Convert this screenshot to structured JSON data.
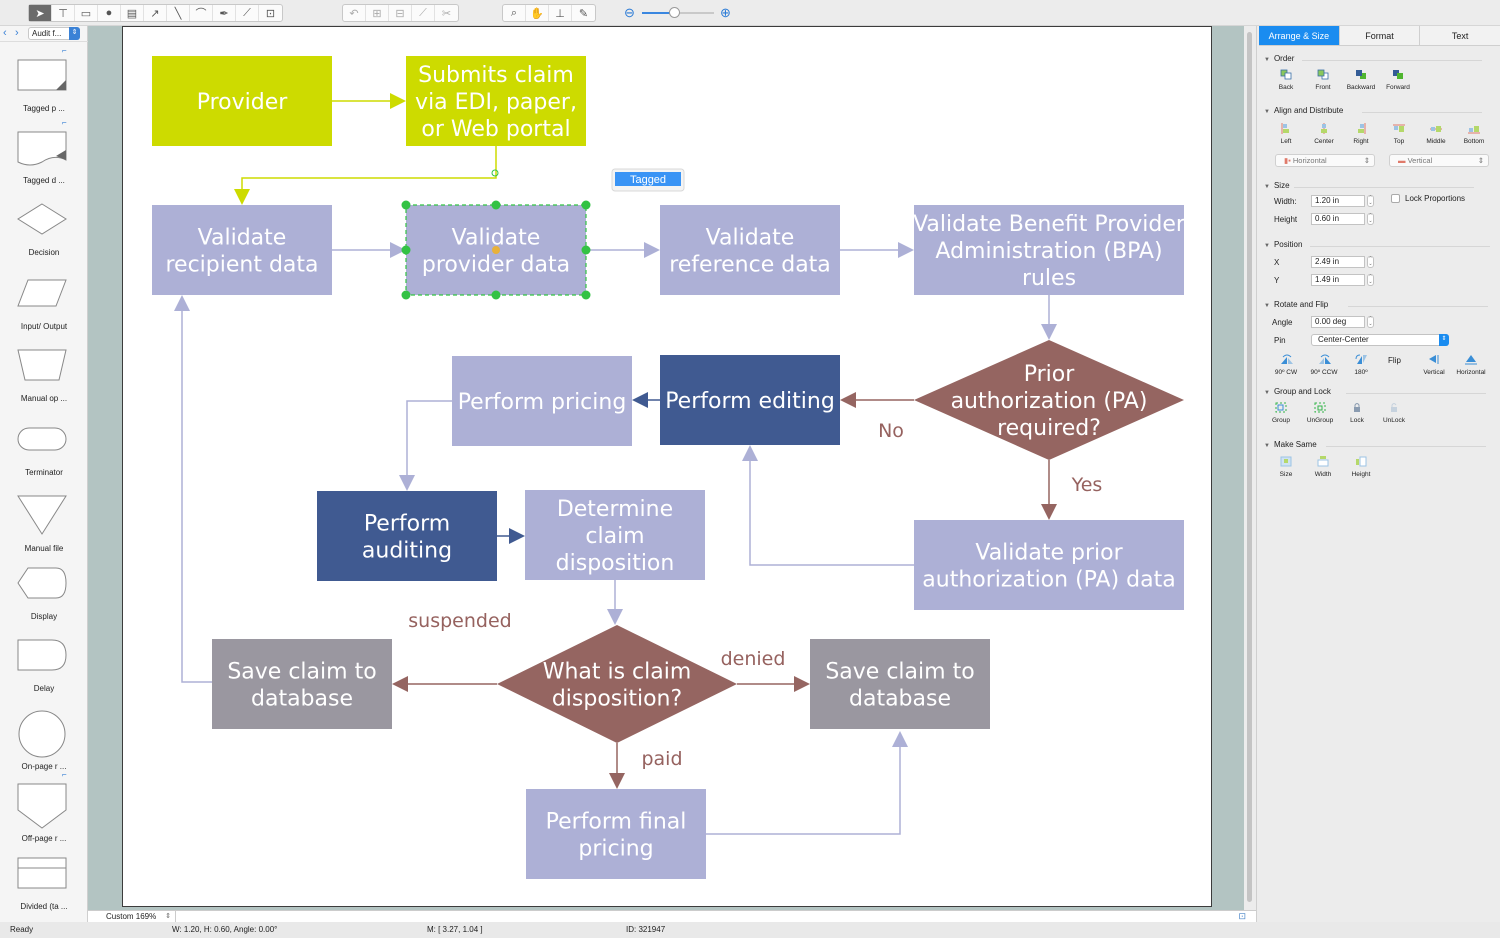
{
  "toolbar": {
    "draw_tools": [
      "pointer",
      "text-box",
      "rectangle",
      "ellipse",
      "note",
      "arrow",
      "line",
      "arc",
      "pen",
      "bezier-select",
      "insert-container"
    ],
    "edit_tools": [
      "rotate",
      "group",
      "ungroup",
      "connect",
      "disconnect"
    ],
    "view_tools": [
      "search",
      "pan",
      "stamp",
      "eyedropper"
    ],
    "zoom_level": 0.45
  },
  "library": {
    "selector_label": "Audit f...",
    "items": [
      {
        "label": "Tagged p ...",
        "shape": "tagged-process",
        "tagged": true
      },
      {
        "label": "Tagged d ...",
        "shape": "tagged-document",
        "tagged": true
      },
      {
        "label": "Decision",
        "shape": "decision"
      },
      {
        "label": "Input/ Output",
        "shape": "input-output"
      },
      {
        "label": "Manual op ...",
        "shape": "manual-operation"
      },
      {
        "label": "Terminator",
        "shape": "terminator"
      },
      {
        "label": "Manual file",
        "shape": "manual-file"
      },
      {
        "label": "Display",
        "shape": "display"
      },
      {
        "label": "Delay",
        "shape": "delay"
      },
      {
        "label": "On-page r ...",
        "shape": "on-page-reference"
      },
      {
        "label": "Off-page r ...",
        "shape": "off-page-reference",
        "tagged": true
      },
      {
        "label": "Divided (ta ...",
        "shape": "divided"
      }
    ]
  },
  "diagram": {
    "colors": {
      "green": "#cddb00",
      "green_text": "#5a5a6a",
      "lavender": "#adb0d6",
      "navy": "#405a91",
      "mauve": "#956561",
      "gray": "#9a97a0",
      "edge_lavender": "#adb0d6",
      "edge_green": "#cddb00",
      "edge_mauve": "#956561",
      "edge_navy": "#405a91",
      "selection": "#33c244"
    },
    "nodes": [
      {
        "id": "provider",
        "lines": [
          "Provider"
        ],
        "style": "green",
        "shape": "rect"
      },
      {
        "id": "submits",
        "lines": [
          "Submits claim",
          "via EDI, paper,",
          "or Web portal"
        ],
        "style": "green",
        "shape": "rect"
      },
      {
        "id": "val-recipient",
        "lines": [
          "Validate",
          "recipient data"
        ],
        "style": "lavender",
        "shape": "rect"
      },
      {
        "id": "val-provider",
        "lines": [
          "Validate",
          "provider data"
        ],
        "style": "lavender",
        "shape": "rect",
        "selected": true
      },
      {
        "id": "val-reference",
        "lines": [
          "Validate",
          "reference data"
        ],
        "style": "lavender",
        "shape": "rect"
      },
      {
        "id": "val-bpa",
        "lines": [
          "Validate Benefit Provider",
          "Administration (BPA)",
          "rules"
        ],
        "style": "lavender",
        "shape": "rect"
      },
      {
        "id": "pa-required",
        "lines": [
          "Prior",
          "authorization (PA)",
          "required?"
        ],
        "style": "mauve",
        "shape": "diamond"
      },
      {
        "id": "perform-editing",
        "lines": [
          "Perform editing"
        ],
        "style": "navy",
        "shape": "rect"
      },
      {
        "id": "perform-pricing",
        "lines": [
          "Perform pricing"
        ],
        "style": "lavender",
        "shape": "rect"
      },
      {
        "id": "perform-auditing",
        "lines": [
          "Perform",
          "auditing"
        ],
        "style": "navy",
        "shape": "rect"
      },
      {
        "id": "determine-disposition",
        "lines": [
          "Determine",
          "claim",
          "disposition"
        ],
        "style": "lavender",
        "shape": "rect"
      },
      {
        "id": "val-pa",
        "lines": [
          "Validate prior",
          "authorization (PA) data"
        ],
        "style": "lavender",
        "shape": "rect"
      },
      {
        "id": "what-disposition",
        "lines": [
          "What is claim",
          "disposition?"
        ],
        "style": "mauve",
        "shape": "diamond"
      },
      {
        "id": "save-suspended",
        "lines": [
          "Save claim to",
          "database"
        ],
        "style": "gray",
        "shape": "rect"
      },
      {
        "id": "save-denied",
        "lines": [
          "Save claim to",
          "database"
        ],
        "style": "gray",
        "shape": "rect"
      },
      {
        "id": "final-pricing",
        "lines": [
          "Perform final",
          "pricing"
        ],
        "style": "lavender",
        "shape": "rect"
      }
    ],
    "edges": [
      {
        "from": "provider",
        "to": "submits",
        "color": "edge_green"
      },
      {
        "from": "submits",
        "to": "val-recipient",
        "color": "edge_green"
      },
      {
        "from": "val-recipient",
        "to": "val-provider",
        "color": "edge_lavender"
      },
      {
        "from": "val-provider",
        "to": "val-reference",
        "color": "edge_lavender"
      },
      {
        "from": "val-reference",
        "to": "val-bpa",
        "color": "edge_lavender"
      },
      {
        "from": "val-bpa",
        "to": "pa-required",
        "color": "edge_lavender"
      },
      {
        "from": "pa-required",
        "to": "perform-editing",
        "color": "edge_mauve",
        "label": "No"
      },
      {
        "from": "pa-required",
        "to": "val-pa",
        "color": "edge_mauve",
        "label": "Yes"
      },
      {
        "from": "val-pa",
        "to": "perform-editing",
        "color": "edge_lavender"
      },
      {
        "from": "perform-editing",
        "to": "perform-pricing",
        "color": "edge_navy"
      },
      {
        "from": "perform-pricing",
        "to": "perform-auditing",
        "color": "edge_lavender"
      },
      {
        "from": "perform-auditing",
        "to": "determine-disposition",
        "color": "edge_navy"
      },
      {
        "from": "determine-disposition",
        "to": "what-disposition",
        "color": "edge_lavender"
      },
      {
        "from": "what-disposition",
        "to": "save-suspended",
        "color": "edge_mauve",
        "label": "suspended"
      },
      {
        "from": "what-disposition",
        "to": "save-denied",
        "color": "edge_mauve",
        "label": "denied"
      },
      {
        "from": "what-disposition",
        "to": "final-pricing",
        "color": "edge_mauve",
        "label": "paid"
      },
      {
        "from": "final-pricing",
        "to": "save-denied",
        "color": "edge_lavender"
      },
      {
        "from": "save-suspended",
        "to": "val-recipient",
        "color": "edge_lavender"
      }
    ],
    "tag_popup": "Tagged"
  },
  "inspector": {
    "tabs": [
      {
        "label": "Arrange & Size",
        "active": true
      },
      {
        "label": "Format",
        "active": false
      },
      {
        "label": "Text",
        "active": false
      }
    ],
    "order": {
      "title": "Order",
      "buttons": [
        "Back",
        "Front",
        "Backward",
        "Forward"
      ]
    },
    "align": {
      "title": "Align and Distribute",
      "buttons": [
        "Left",
        "Center",
        "Right",
        "Top",
        "Middle",
        "Bottom"
      ],
      "horizontal": "Horizontal",
      "vertical": "Vertical"
    },
    "size": {
      "title": "Size",
      "width_label": "Width:",
      "width": "1.20 in",
      "height_label": "Height",
      "height": "0.60 in",
      "lock_label": "Lock Proportions",
      "lock_checked": false
    },
    "position": {
      "title": "Position",
      "x_label": "X",
      "x": "2.49 in",
      "y_label": "Y",
      "y": "1.49 in"
    },
    "rotate": {
      "title": "Rotate and Flip",
      "angle_label": "Angle",
      "angle": "0.00 deg",
      "pin_label": "Pin",
      "pin": "Center-Center",
      "buttons": [
        "90º CW",
        "90º CCW",
        "180º"
      ],
      "flip_label": "Flip",
      "flip_buttons": [
        "Vertical",
        "Horizontal"
      ]
    },
    "group": {
      "title": "Group and Lock",
      "buttons": [
        "Group",
        "UnGroup",
        "Lock",
        "UnLock"
      ]
    },
    "same": {
      "title": "Make Same",
      "buttons": [
        "Size",
        "Width",
        "Height"
      ]
    }
  },
  "bottom": {
    "zoom_label": "Custom 169%"
  },
  "status": {
    "ready": "Ready",
    "dims": "W: 1.20,  H: 0.60,  Angle: 0.00°",
    "mouse": "M: [ 3.27, 1.04 ]",
    "id": "ID: 321947"
  }
}
